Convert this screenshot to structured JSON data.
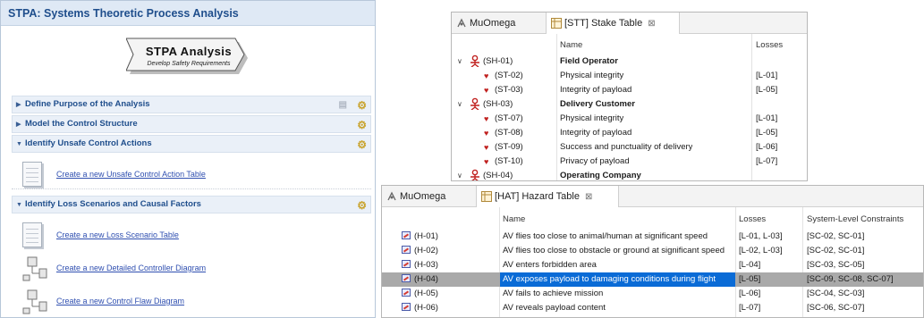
{
  "stpa": {
    "title": "STPA: Systems Theoretic Process Analysis",
    "banner_title": "STPA Analysis",
    "banner_subtitle": "Develop Safety Requirements",
    "sections": [
      {
        "label": "Define Purpose of the Analysis",
        "expanded": false
      },
      {
        "label": "Model the Control Structure",
        "expanded": false
      },
      {
        "label": "Identify Unsafe Control Actions",
        "expanded": true
      },
      {
        "label": "Identify Loss Scenarios and Causal Factors",
        "expanded": true
      }
    ],
    "tasks": [
      "Create a new Unsafe Control Action Table",
      "Create a new Loss Scenario Table",
      "Create a new Detailed Controller Diagram",
      "Create a new Control Flaw Diagram"
    ]
  },
  "stake": {
    "tabs": [
      {
        "label": "MuOmega"
      },
      {
        "label": "[STT] Stake Table"
      }
    ],
    "close_glyph": "⊠",
    "headers": {
      "name": "Name",
      "losses": "Losses"
    },
    "rows": [
      {
        "id": "(SH-01)",
        "name": "Field Operator",
        "losses": "",
        "level": 0
      },
      {
        "id": "(ST-02)",
        "name": "Physical integrity",
        "losses": "[L-01]",
        "level": 1
      },
      {
        "id": "(ST-03)",
        "name": "Integrity of payload",
        "losses": "[L-05]",
        "level": 1
      },
      {
        "id": "(SH-03)",
        "name": "Delivery Customer",
        "losses": "",
        "level": 0
      },
      {
        "id": "(ST-07)",
        "name": "Physical integrity",
        "losses": "[L-01]",
        "level": 1
      },
      {
        "id": "(ST-08)",
        "name": "Integrity of payload",
        "losses": "[L-05]",
        "level": 1
      },
      {
        "id": "(ST-09)",
        "name": "Success and punctuality of delivery",
        "losses": "[L-06]",
        "level": 1
      },
      {
        "id": "(ST-10)",
        "name": "Privacy of payload",
        "losses": "[L-07]",
        "level": 1
      },
      {
        "id": "(SH-04)",
        "name": "Operating Company",
        "losses": "",
        "level": 0
      }
    ]
  },
  "hazard": {
    "tabs": [
      {
        "label": "MuOmega"
      },
      {
        "label": "[HAT] Hazard Table"
      }
    ],
    "close_glyph": "⊠",
    "headers": {
      "name": "Name",
      "losses": "Losses",
      "constraints": "System-Level Constraints"
    },
    "rows": [
      {
        "id": "(H-01)",
        "name": "AV flies too close to animal/human at significant speed",
        "losses": "[L-01, L-03]",
        "constraints": "[SC-02, SC-01]"
      },
      {
        "id": "(H-02)",
        "name": "AV flies too close to obstacle or ground at significant speed",
        "losses": "[L-02, L-03]",
        "constraints": "[SC-02, SC-01]"
      },
      {
        "id": "(H-03)",
        "name": "AV enters forbidden area",
        "losses": "[L-04]",
        "constraints": "[SC-03, SC-05]"
      },
      {
        "id": "(H-04)",
        "name": "AV exposes payload to damaging conditions during flight",
        "losses": "[L-05]",
        "constraints": "[SC-09, SC-08, SC-07]",
        "selected": true
      },
      {
        "id": "(H-05)",
        "name": "AV fails to achieve mission",
        "losses": "[L-06]",
        "constraints": "[SC-04, SC-03]"
      },
      {
        "id": "(H-06)",
        "name": "AV reveals payload content",
        "losses": "[L-07]",
        "constraints": "[SC-06, SC-07]"
      }
    ]
  }
}
